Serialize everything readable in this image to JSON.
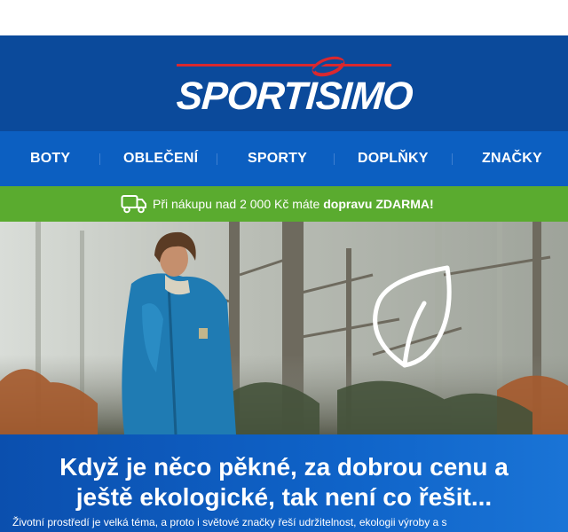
{
  "brand": {
    "logo_text": "SPORTISIMO",
    "primary_color": "#0b4a9b",
    "accent_color": "#d9282f"
  },
  "nav": {
    "items": [
      {
        "label": "BOTY"
      },
      {
        "label": "OBLEČENÍ"
      },
      {
        "label": "SPORTY"
      },
      {
        "label": "DOPLŇKY"
      },
      {
        "label": "ZNAČKY"
      }
    ]
  },
  "promo": {
    "icon": "delivery-truck-icon",
    "text_prefix": "Při nákupu nad 2 000 Kč máte",
    "text_bold": "dopravu ZDARMA!",
    "color": "#5aab2f"
  },
  "hero": {
    "image_subject": "man in blue rain jacket in misty forest",
    "overlay_icon": "leaf-icon"
  },
  "banner": {
    "headline_line1": "Když je něco pěkné, za dobrou cenu a",
    "headline_line2": "ještě ekologické, tak není co řešit...",
    "body": "Životní prostředí je velká téma, a proto i světové značky řeší udržitelnost, ekologii výroby a s"
  }
}
